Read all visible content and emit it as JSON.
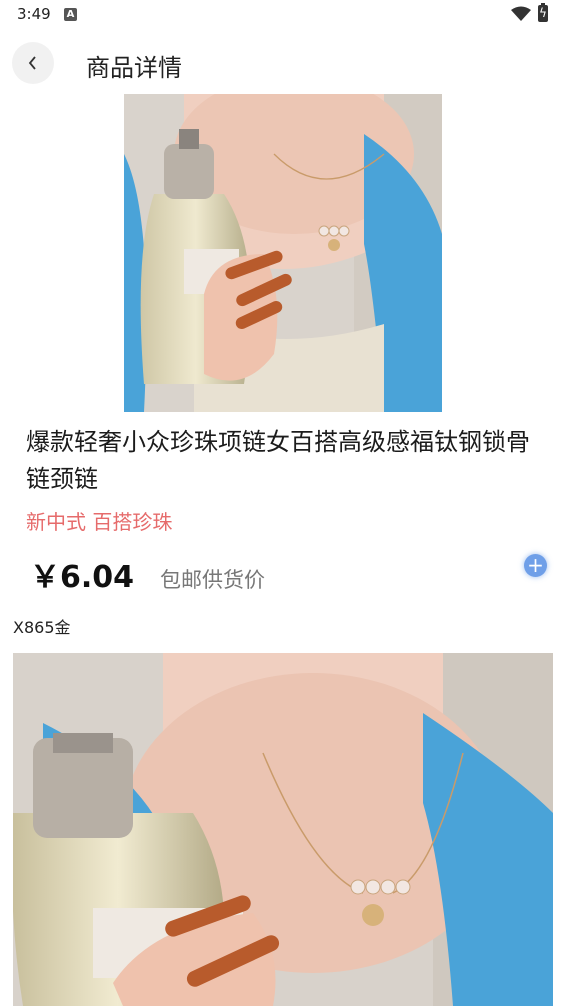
{
  "status_bar": {
    "time": "3:49",
    "notification_icon": "a-letter-icon",
    "wifi_icon": "wifi-icon",
    "battery_icon": "battery-charging-icon"
  },
  "header": {
    "back_icon": "chevron-left-icon",
    "title": "商品详情"
  },
  "product": {
    "title": "爆款轻奢小众珍珠项链女百搭高级感福钛钢锁骨链颈链",
    "tags": "新中式 百搭珍珠",
    "price": "￥6.04",
    "price_note": "包邮供货价",
    "add_icon": "plus-icon",
    "sku": "X865金"
  },
  "colors": {
    "tag_red": "#e66b6b",
    "add_blue": "#6f9fe8"
  }
}
